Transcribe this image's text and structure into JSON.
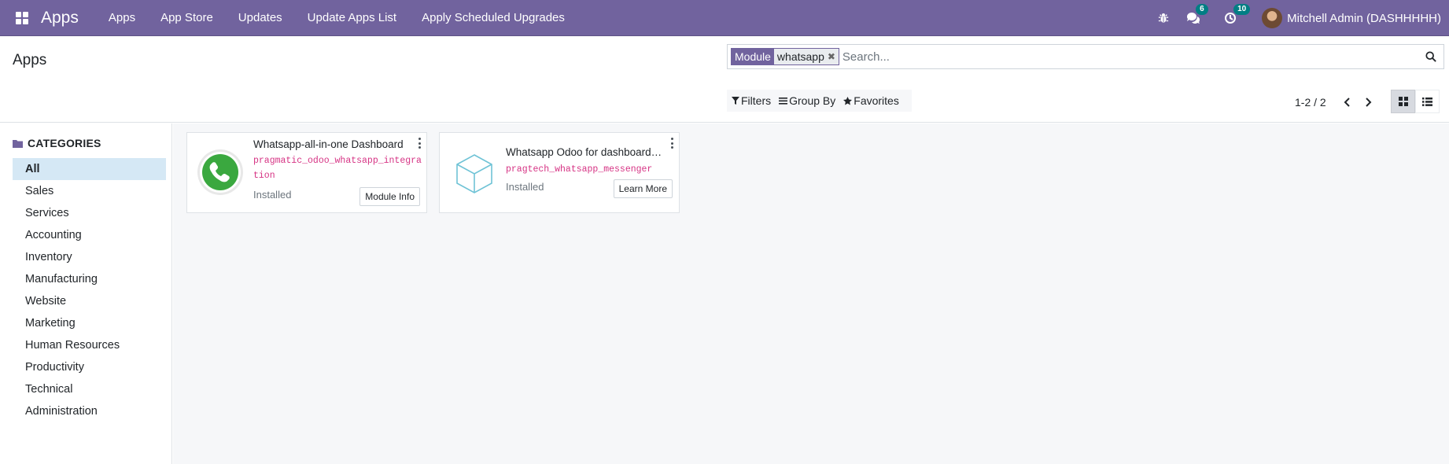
{
  "navbar": {
    "brand": "Apps",
    "menu": [
      "Apps",
      "App Store",
      "Updates",
      "Update Apps List",
      "Apply Scheduled Upgrades"
    ],
    "messages_count": "6",
    "activities_count": "10",
    "user_name": "Mitchell Admin (DASHHHHH)",
    "color": "#71639e"
  },
  "control_panel": {
    "title": "Apps",
    "search": {
      "facet_label": "Module",
      "facet_value": "whatsapp",
      "placeholder": "Search..."
    },
    "filters_label": "Filters",
    "group_by_label": "Group By",
    "favorites_label": "Favorites",
    "pager_text": "1-2 / 2",
    "active_view": "kanban"
  },
  "sidebar": {
    "header": "CATEGORIES",
    "categories": [
      "All",
      "Sales",
      "Services",
      "Accounting",
      "Inventory",
      "Manufacturing",
      "Website",
      "Marketing",
      "Human Resources",
      "Productivity",
      "Technical",
      "Administration"
    ],
    "active_category": "All"
  },
  "apps": [
    {
      "name": "Whatsapp-all-in-one Dashboard",
      "technical_name": "pragmatic_odoo_whatsapp_integration",
      "status": "Installed",
      "button_label": "Module Info",
      "icon": "whatsapp-logo-icon"
    },
    {
      "name": "Whatsapp Odoo for dashboard…",
      "technical_name": "pragtech_whatsapp_messenger",
      "status": "Installed",
      "button_label": "Learn More",
      "icon": "cube-icon"
    }
  ]
}
